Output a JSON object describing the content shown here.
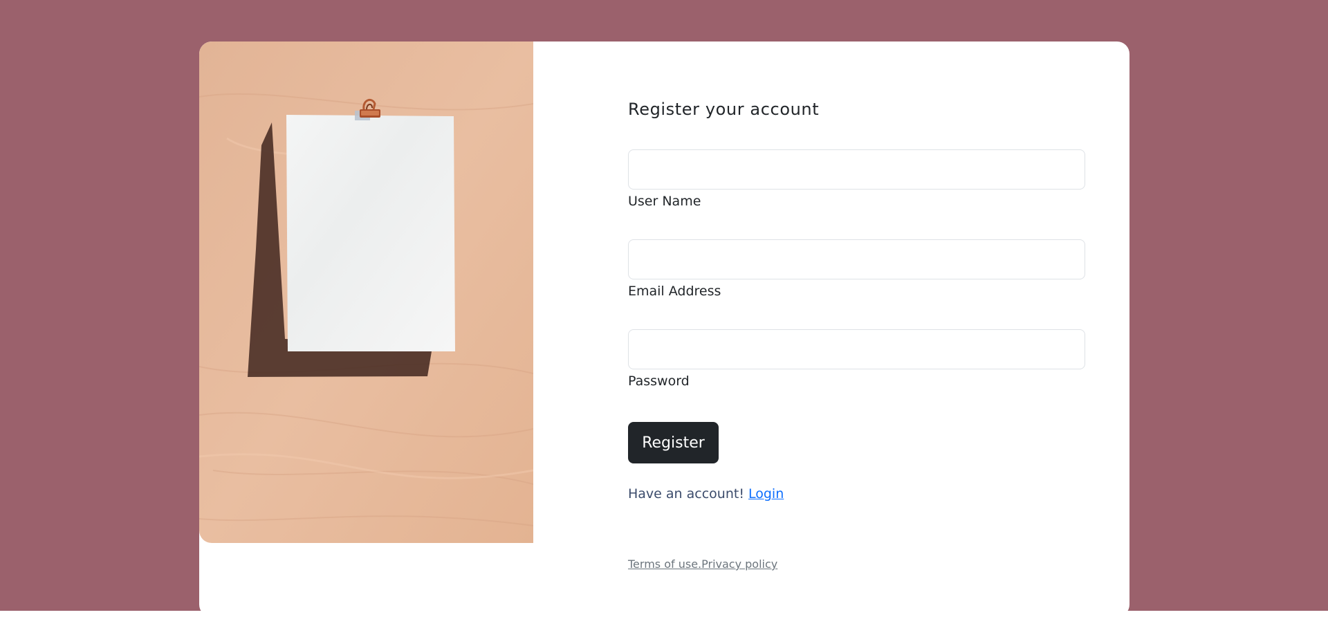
{
  "form": {
    "title": "Register your account",
    "fields": {
      "username": {
        "label": "User Name",
        "value": ""
      },
      "email": {
        "label": "Email Address",
        "value": ""
      },
      "password": {
        "label": "Password",
        "value": ""
      }
    },
    "submit_label": "Register",
    "have_account_text": "Have an account!",
    "login_link_label": "Login"
  },
  "footer": {
    "terms_label": "Terms of use.",
    "privacy_label": "Privacy policy"
  },
  "colors": {
    "page_background": "#9b616c",
    "card_background": "#ffffff",
    "button_background": "#212529",
    "link": "#0d6efd",
    "wood": "#e6b99b"
  },
  "image": {
    "description_icon": "paper-with-binder-clip-on-wood-photo"
  }
}
